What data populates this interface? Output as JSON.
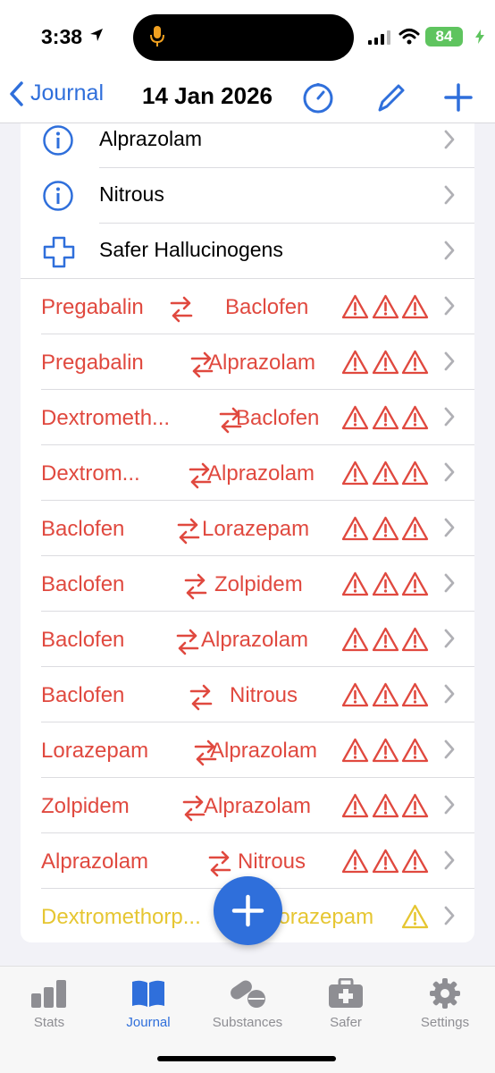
{
  "status_bar": {
    "time": "3:38",
    "battery": "84"
  },
  "nav": {
    "back_label": "Journal",
    "title": "14 Jan 2026"
  },
  "info_rows": [
    {
      "label": "Alprazolam",
      "icon": "info-icon"
    },
    {
      "label": "Nitrous",
      "icon": "info-icon"
    },
    {
      "label": "Safer Hallucinogens",
      "icon": "cross-icon"
    }
  ],
  "interactions": [
    {
      "a": "Pregabalin",
      "b": "Baclofen",
      "level": 3
    },
    {
      "a": "Pregabalin",
      "b": "Alprazolam",
      "level": 3
    },
    {
      "a": "Dextrometh...",
      "b": "Baclofen",
      "level": 3
    },
    {
      "a": "Dextrom...",
      "b": "Alprazolam",
      "level": 3
    },
    {
      "a": "Baclofen",
      "b": "Lorazepam",
      "level": 3
    },
    {
      "a": "Baclofen",
      "b": "Zolpidem",
      "level": 3
    },
    {
      "a": "Baclofen",
      "b": "Alprazolam",
      "level": 3
    },
    {
      "a": "Baclofen",
      "b": "Nitrous",
      "level": 3
    },
    {
      "a": "Lorazepam",
      "b": "Alprazolam",
      "level": 3
    },
    {
      "a": "Zolpidem",
      "b": "Alprazolam",
      "level": 3
    },
    {
      "a": "Alprazolam",
      "b": "Nitrous",
      "level": 3
    },
    {
      "a": "Dextromethorp...",
      "b": "Lorazepam",
      "level": 1
    }
  ],
  "tabs": [
    {
      "label": "Stats",
      "icon": "stats-icon",
      "active": false
    },
    {
      "label": "Journal",
      "icon": "journal-book-icon",
      "active": true
    },
    {
      "label": "Substances",
      "icon": "pills-icon",
      "active": false
    },
    {
      "label": "Safer",
      "icon": "first-aid-kit-icon",
      "active": false
    },
    {
      "label": "Settings",
      "icon": "gear-icon",
      "active": false
    }
  ],
  "colors": {
    "accent": "#2f6fdb",
    "danger": "#e0493f",
    "warning": "#e6c632",
    "battery": "#5fc45f"
  }
}
